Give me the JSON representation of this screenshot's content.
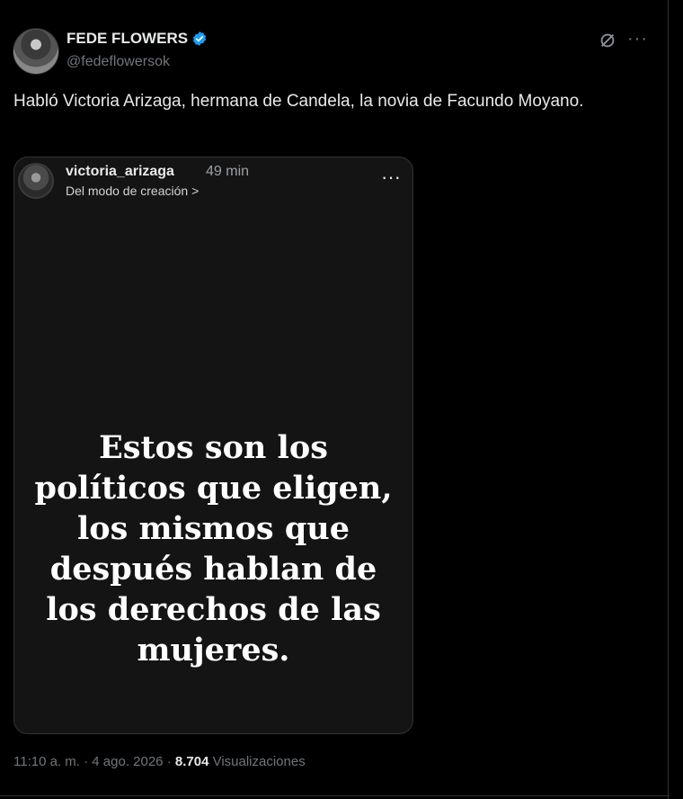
{
  "author": {
    "name": "FEDE FLOWERS",
    "handle": "@fedeflowersok",
    "verified_color": "#1d9bf0"
  },
  "tweet": {
    "text": "Habló Victoria Arizaga, hermana de Candela, la novia de Facundo Moyano."
  },
  "media": {
    "story_user": "victoria_arizaga",
    "story_time": "49 min",
    "story_mode": "Del modo de creación >",
    "quote": "Estos son los\npolíticos que eligen,\nlos mismos que\ndespués hablan de\nlos derechos de las\nmujeres."
  },
  "meta": {
    "time": "11:10 a. m.",
    "separator": "·",
    "date": "4 ago. 2026",
    "views_count": "8.704",
    "views_label": "Visualizaciones"
  },
  "icons": {
    "verified": "verified-badge-icon",
    "grok": "grok-icon",
    "more": "more-icon"
  }
}
